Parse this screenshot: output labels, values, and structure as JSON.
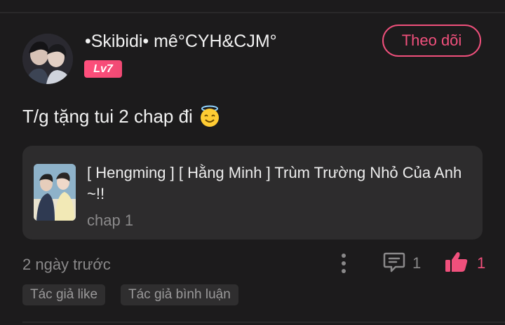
{
  "comment": {
    "username": "•Skibidi• mê°CYH&CJM°",
    "level": "Lv7",
    "follow_label": "Theo dõi",
    "text": "T/g tặng tui 2 chap đi",
    "emoji": "smiling-face-with-halo-icon",
    "story": {
      "title": "[ Hengming ] [ Hằng Minh ] Trùm Trường Nhỏ Của Anh ~!!",
      "chapter": "chap 1"
    },
    "timestamp": "2 ngày trước",
    "reply_count": "1",
    "like_count": "1",
    "tags": [
      "Tác giả like",
      "Tác giả bình luận"
    ]
  },
  "colors": {
    "background": "#1c1b1c",
    "card": "#2d2c2d",
    "accent": "#f0507c",
    "muted_text": "#8a898a"
  }
}
